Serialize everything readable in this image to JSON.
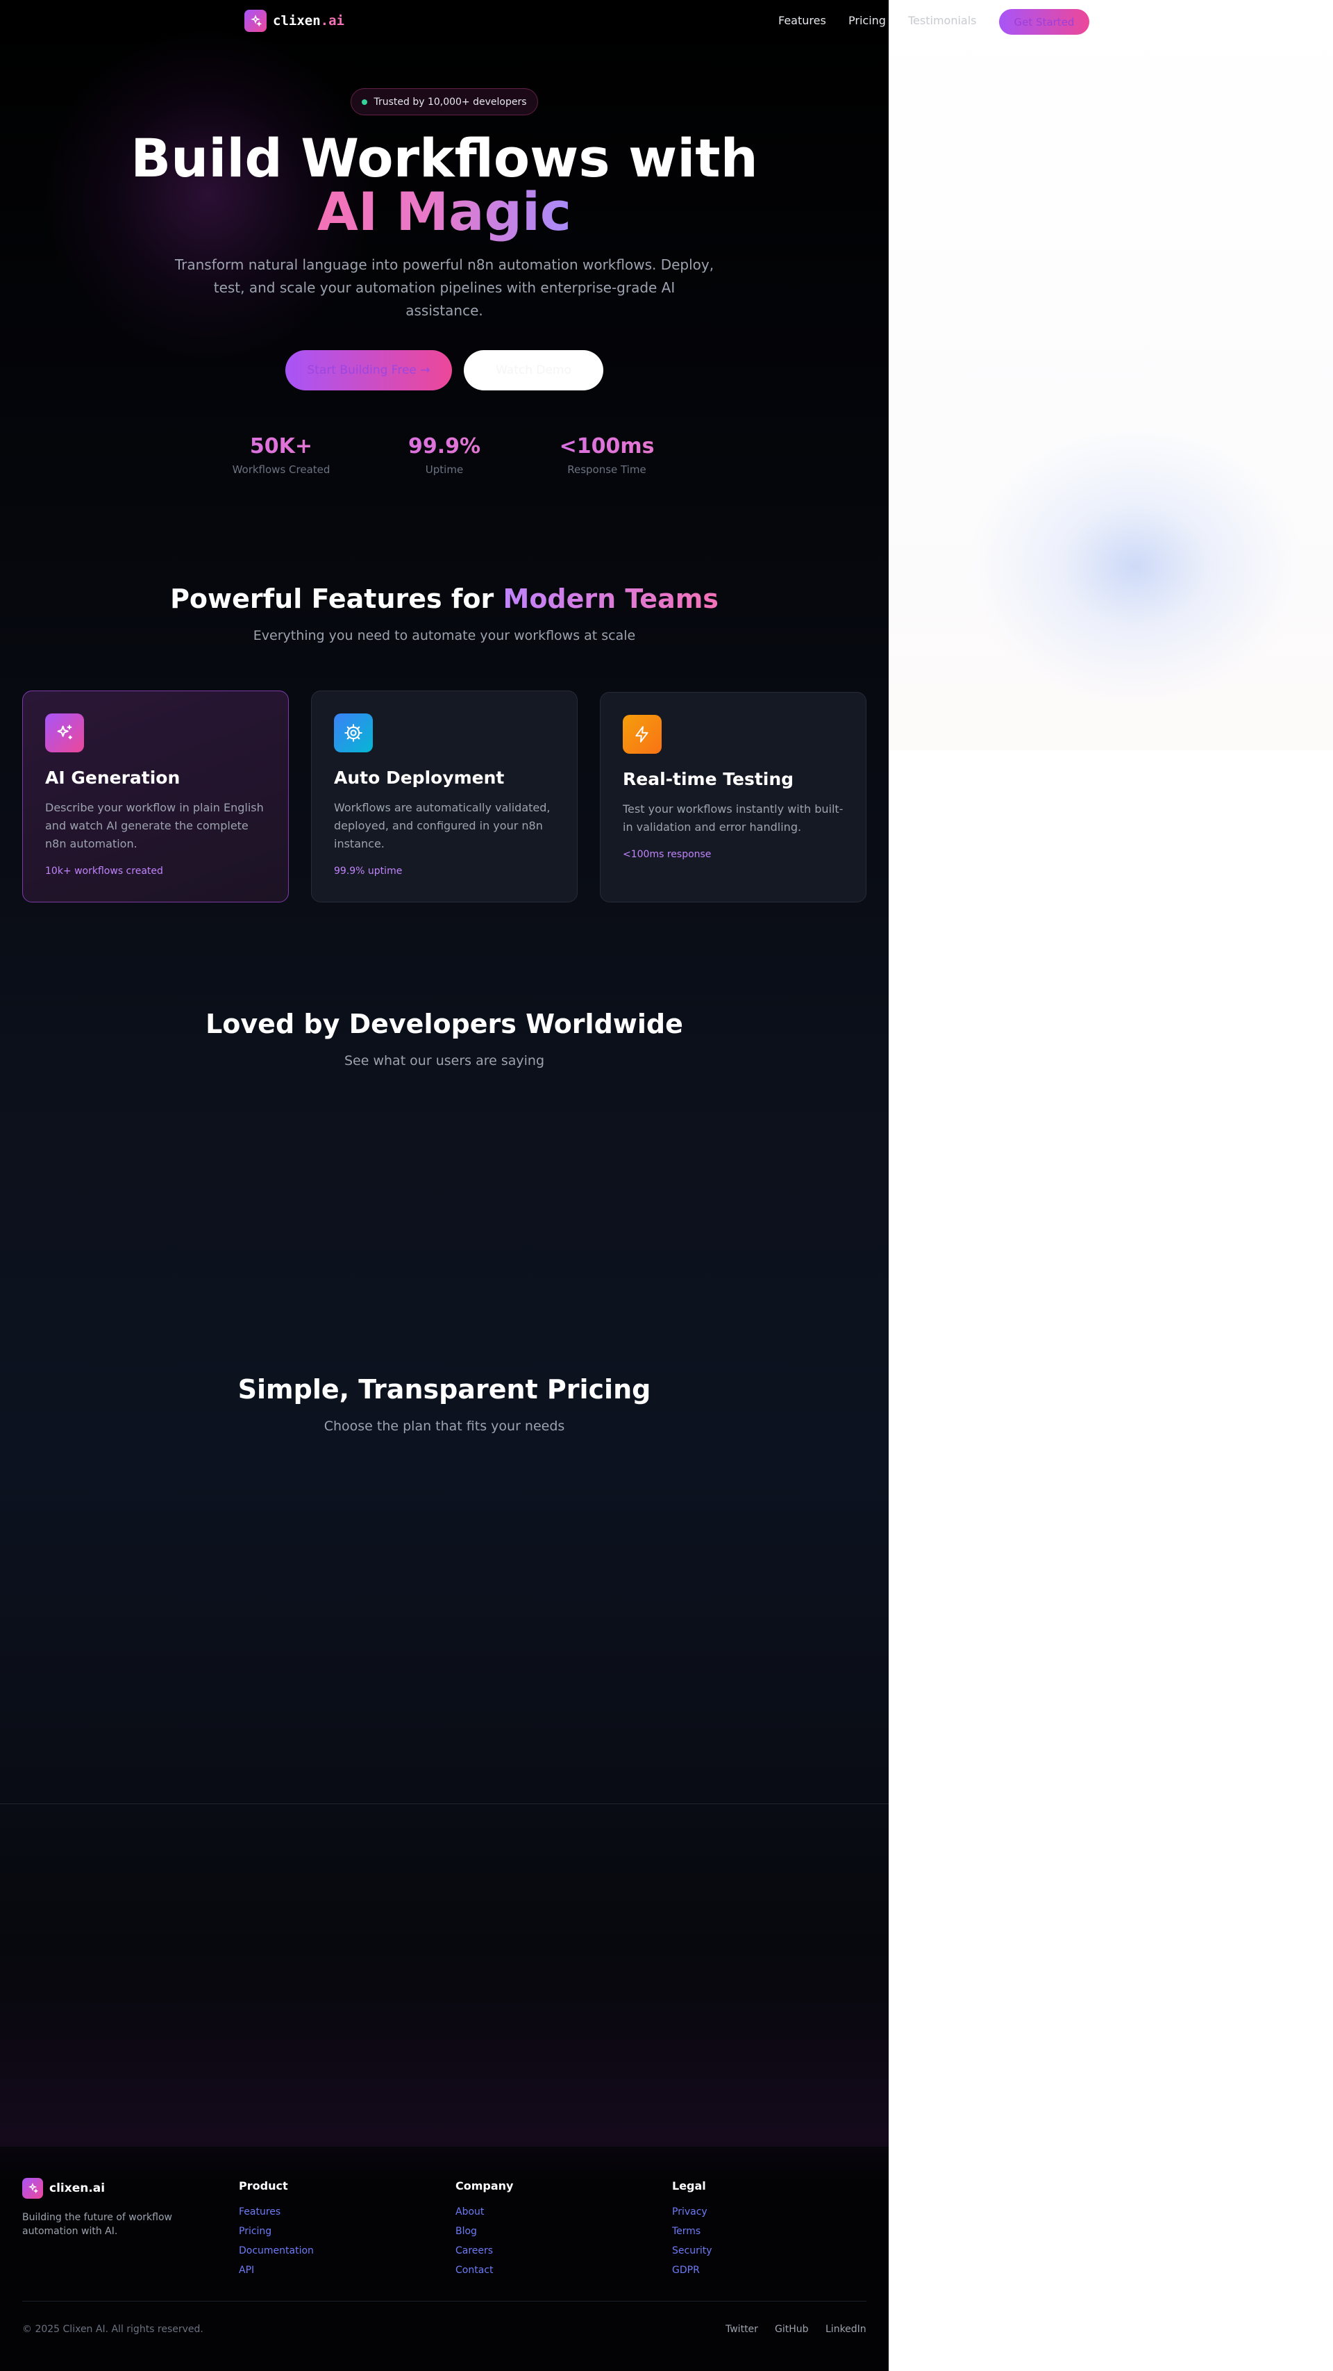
{
  "nav": {
    "logo_main": "clixen",
    "logo_suffix": ".ai",
    "links": [
      "Features",
      "Pricing",
      "Testimonials"
    ],
    "cta": "Get Started"
  },
  "hero": {
    "badge": "Trusted by 10,000+ developers",
    "title_line1": "Build Workflows with",
    "title_line2": "AI Magic",
    "subtitle": "Transform natural language into powerful n8n automation workflows. Deploy, test, and scale your automation pipelines with enterprise-grade AI assistance.",
    "primary_button": "Start Building Free →",
    "secondary_button": "Watch Demo",
    "stats": [
      {
        "value": "50K+",
        "label": "Workflows Created"
      },
      {
        "value": "99.9%",
        "label": "Uptime"
      },
      {
        "value": "<100ms",
        "label": "Response Time"
      }
    ]
  },
  "features": {
    "title_plain": "Powerful Features for ",
    "title_accent": "Modern Teams",
    "subtitle": "Everything you need to automate your workflows at scale",
    "cards": [
      {
        "icon": "sparkles-icon",
        "title": "AI Generation",
        "description": "Describe your workflow in plain English and watch AI generate the complete n8n automation.",
        "stat": "10k+ workflows created",
        "color": "#c04fe0"
      },
      {
        "icon": "gear-icon",
        "title": "Auto Deployment",
        "description": "Workflows are automatically validated, deployed, and configured in your n8n instance.",
        "stat": "99.9% uptime",
        "color": "#2b8fe0"
      },
      {
        "icon": "lightning-icon",
        "title": "Real-time Testing",
        "description": "Test your workflows instantly with built-in validation and error handling.",
        "stat": "<100ms response",
        "color": "#f27a1a"
      }
    ]
  },
  "testimonials": {
    "title": "Loved by Developers Worldwide",
    "subtitle": "See what our users are saying"
  },
  "pricing": {
    "title": "Simple, Transparent Pricing",
    "subtitle": "Choose the plan that fits your needs"
  },
  "footer": {
    "brand": "clixen.ai",
    "tagline": "Building the future of workflow automation with AI.",
    "columns": [
      {
        "title": "Product",
        "links": [
          "Features",
          "Pricing",
          "Documentation",
          "API"
        ]
      },
      {
        "title": "Company",
        "links": [
          "About",
          "Blog",
          "Careers",
          "Contact"
        ]
      },
      {
        "title": "Legal",
        "links": [
          "Privacy",
          "Terms",
          "Security",
          "GDPR"
        ]
      }
    ],
    "copyright": "© 2025 Clixen AI. All rights reserved.",
    "social": [
      "Twitter",
      "GitHub",
      "LinkedIn"
    ]
  }
}
